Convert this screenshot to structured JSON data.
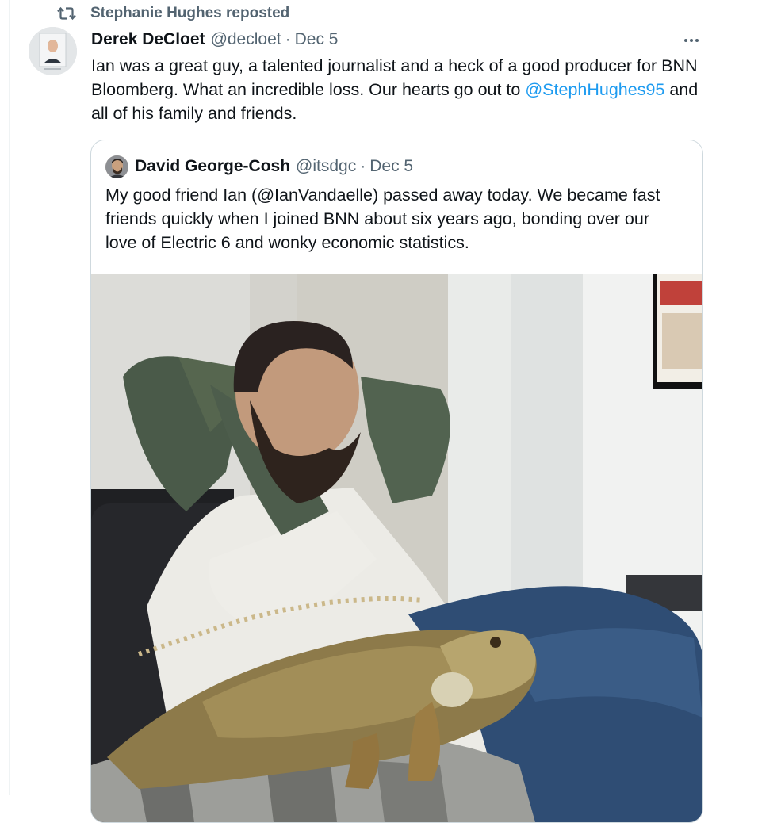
{
  "repost": {
    "label": "Stephanie Hughes reposted",
    "icon": "repost-icon"
  },
  "tweet": {
    "author_name": "Derek DeCloet",
    "author_handle": "@decloet",
    "separator": "·",
    "date": "Dec 5",
    "text_part1": "Ian was a great guy, a talented journalist and a heck of a good producer for BNN Bloomberg. What an incredible loss. Our hearts go out to ",
    "mention": "@StephHughes95",
    "text_part2": " and all of his family and friends.",
    "more_icon": "more-icon"
  },
  "quote": {
    "author_name": "David George-Cosh",
    "author_handle": "@itsdgc",
    "separator": "·",
    "date": "Dec 5",
    "text": "My good friend Ian (@IanVandaelle) passed away today. We became fast friends quickly when I joined BNN about six years ago, bonding over our love of Electric 6 and wonky economic statistics."
  },
  "colors": {
    "text": "#0f1419",
    "secondary": "#536471",
    "link": "#1d9bf0",
    "border": "#cfd9de"
  }
}
